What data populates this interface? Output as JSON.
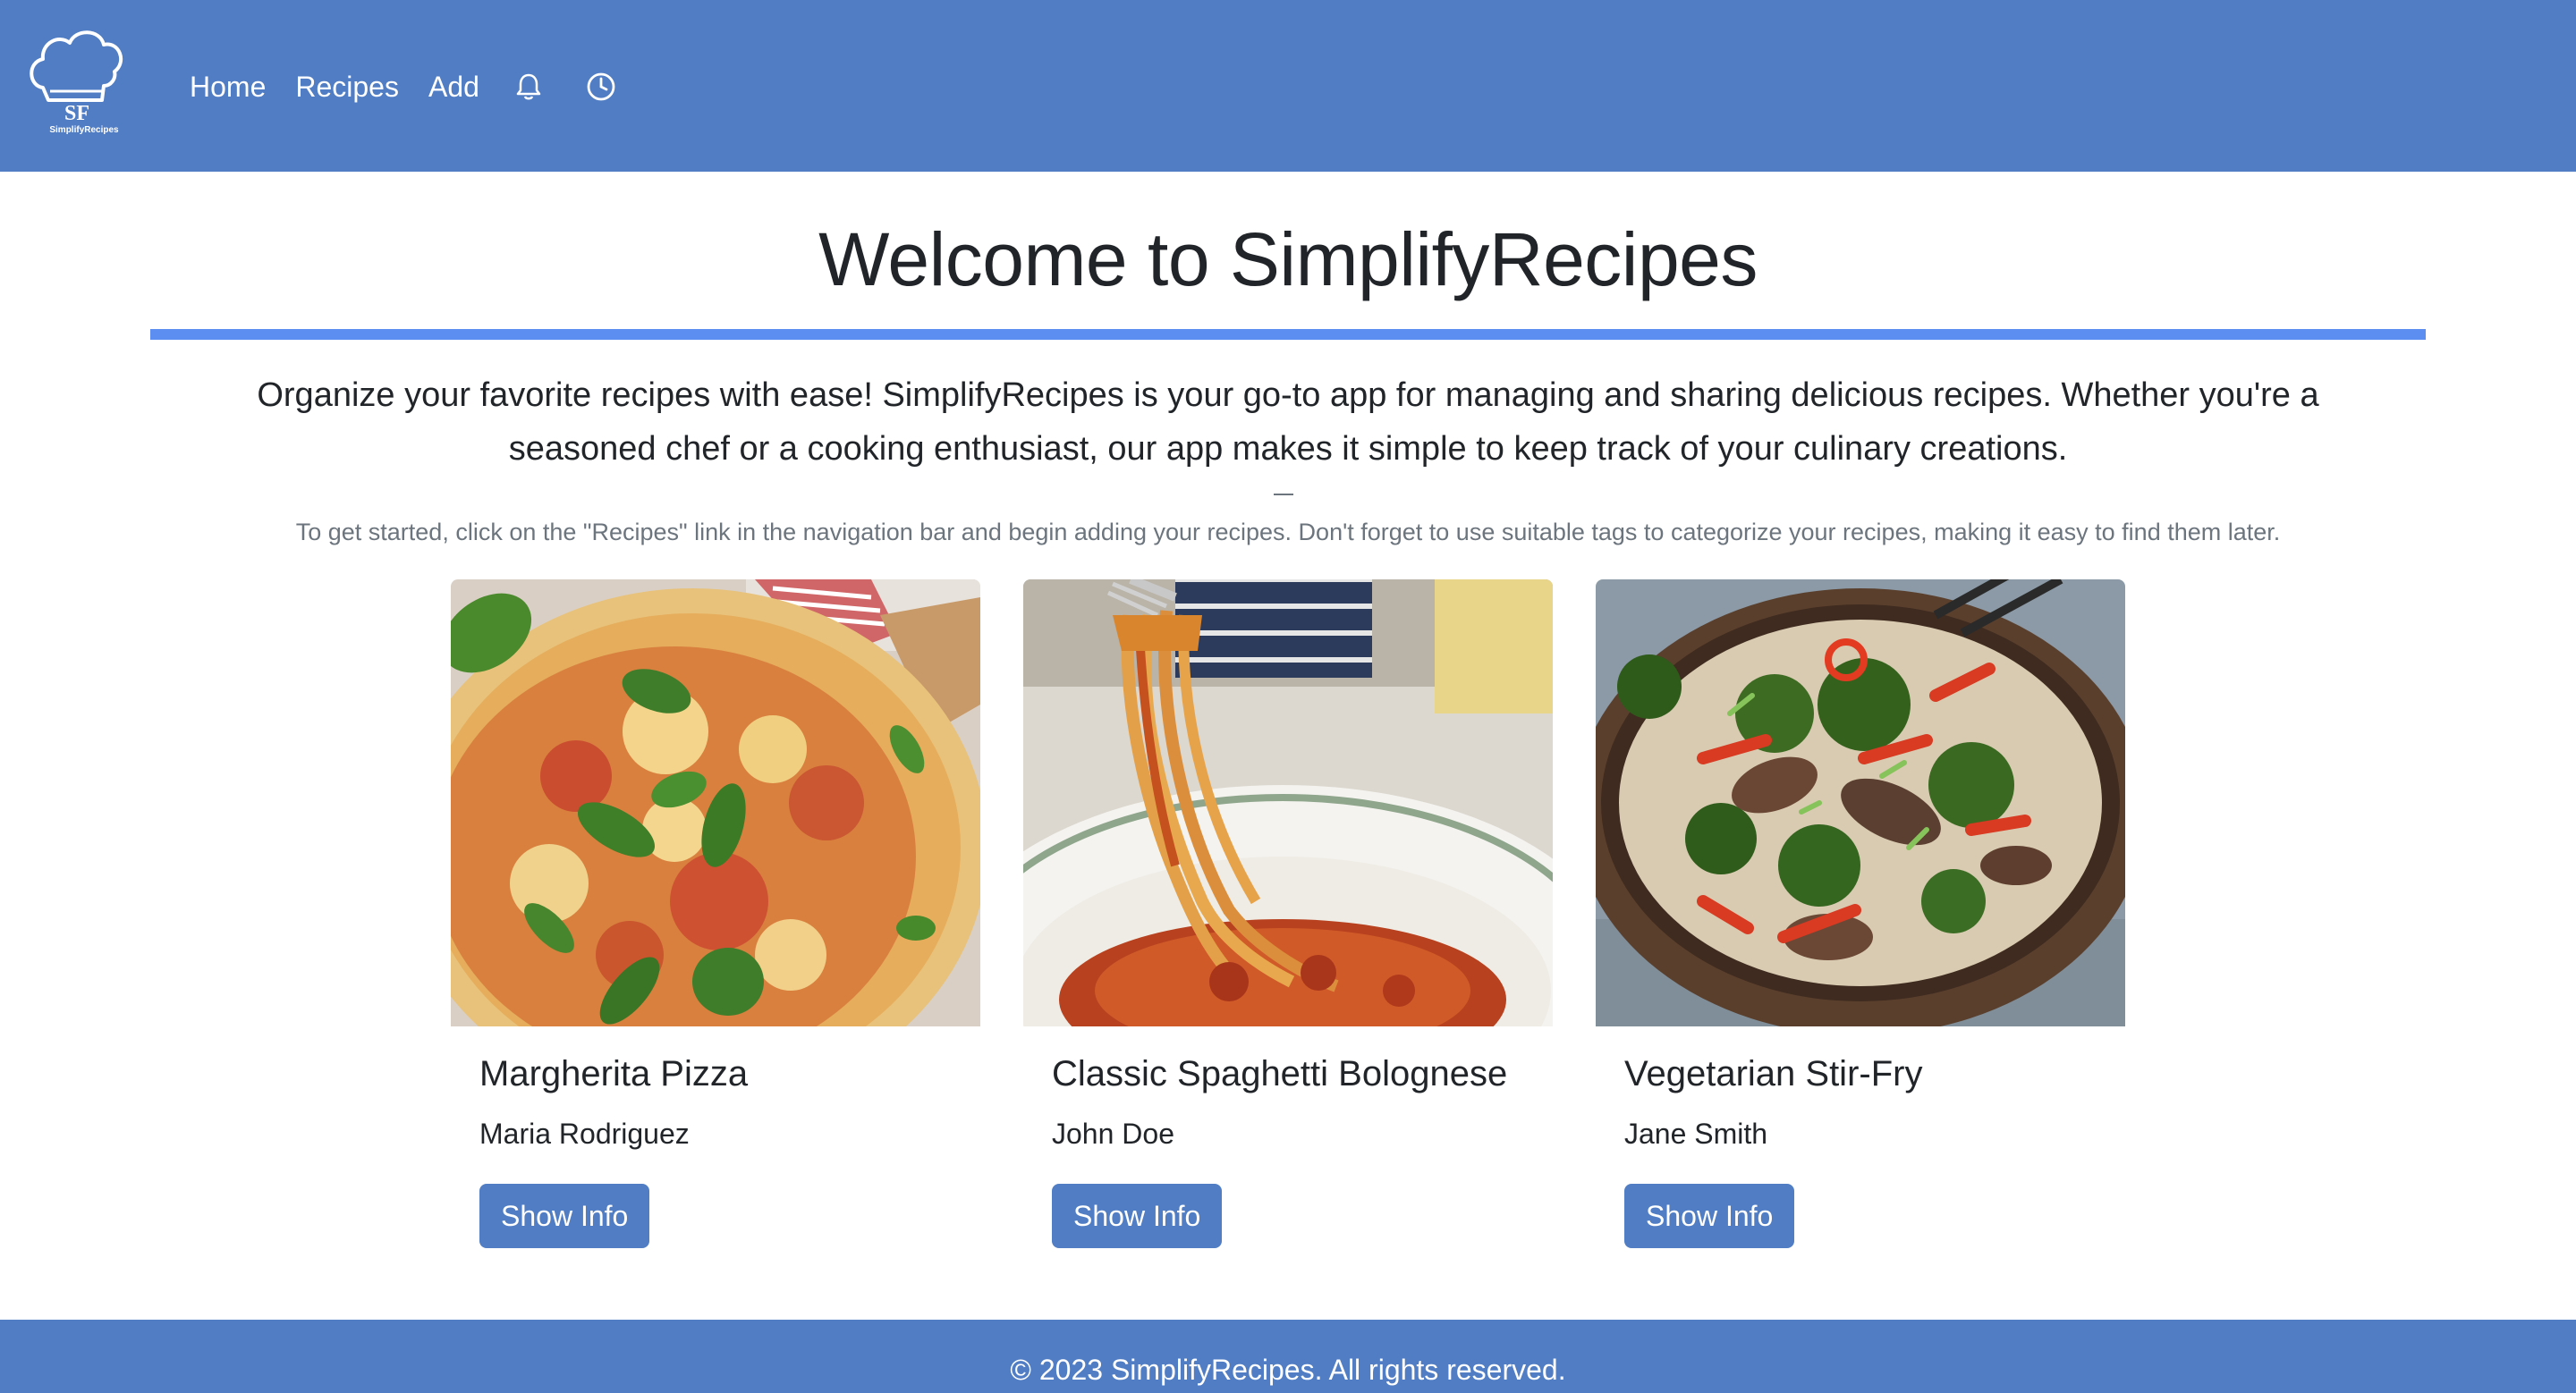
{
  "brand": {
    "monogram": "SF",
    "wordmark": "SimplifyRecipes"
  },
  "nav": {
    "links": [
      "Home",
      "Recipes",
      "Add"
    ],
    "icons": [
      "bell-icon",
      "clock-icon"
    ]
  },
  "main": {
    "title": "Welcome to SimplifyRecipes",
    "intro_line1": "Organize your favorite recipes with ease! SimplifyRecipes is your go-to app for managing and sharing delicious recipes. Whether you're a",
    "intro_line2": "seasoned chef or a cooking enthusiast, our app makes it simple to keep track of your culinary creations.",
    "hint": "To get started, click on the \"Recipes\" link in the navigation bar and begin adding your recipes. Don't forget to use suitable tags to categorize your recipes, making it easy to find them later."
  },
  "cards": [
    {
      "title": "Margherita Pizza",
      "author": "Maria Rodriguez",
      "button": "Show Info"
    },
    {
      "title": "Classic Spaghetti Bolognese",
      "author": "John Doe",
      "button": "Show Info"
    },
    {
      "title": "Vegetarian Stir-Fry",
      "author": "Jane Smith",
      "button": "Show Info"
    }
  ],
  "footer": {
    "text": "© 2023 SimplifyRecipes. All rights reserved."
  },
  "colors": {
    "navbar": "#507dc4",
    "accent_rule": "#5b8ef0",
    "button": "#507dc4",
    "text": "#212529",
    "muted": "#6c757d"
  }
}
